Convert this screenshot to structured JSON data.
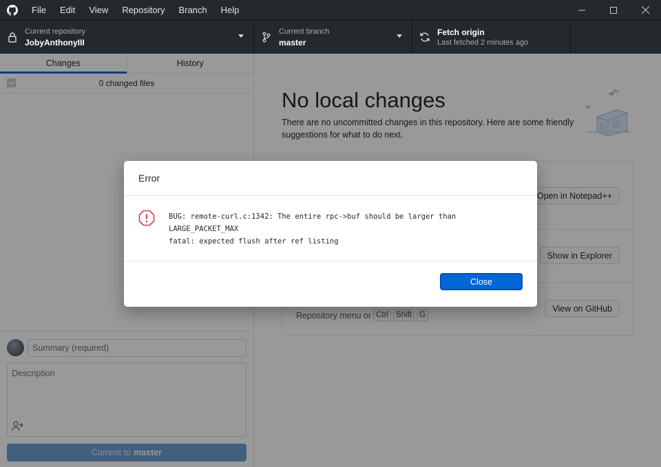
{
  "titlebar": {
    "menu": [
      "File",
      "Edit",
      "View",
      "Repository",
      "Branch",
      "Help"
    ]
  },
  "toolbar": {
    "repo_label": "Current repository",
    "repo_value": "JobyAnthonyIII",
    "branch_label": "Current branch",
    "branch_value": "master",
    "fetch_label": "Fetch origin",
    "fetch_status": "Last fetched 2 minutes ago"
  },
  "sidebar": {
    "tabs": [
      "Changes",
      "History"
    ],
    "changed_files": "0 changed files",
    "summary_placeholder": "Summary (required)",
    "description_placeholder": "Description",
    "commit_prefix": "Commit to",
    "commit_branch": "master"
  },
  "main": {
    "title": "No local changes",
    "description": "There are no uncommitted changes in this repository. Here are some friendly suggestions for what to do next.",
    "suggestions": [
      {
        "button": "Open in Notepad++"
      },
      {
        "button": "Show in Explorer"
      },
      {
        "button": "View on GitHub",
        "hint_prefix": "Repository menu or",
        "keys": [
          "Ctrl",
          "Shift",
          "G"
        ]
      }
    ]
  },
  "dialog": {
    "title": "Error",
    "message": "BUG: remote-curl.c:1342: The entire rpc->buf should be larger than\nLARGE_PACKET_MAX\nfatal: expected flush after ref listing",
    "close_label": "Close"
  },
  "colors": {
    "titlebar_bg": "#24292e",
    "accent": "#0366d6",
    "error": "#d73a49"
  }
}
